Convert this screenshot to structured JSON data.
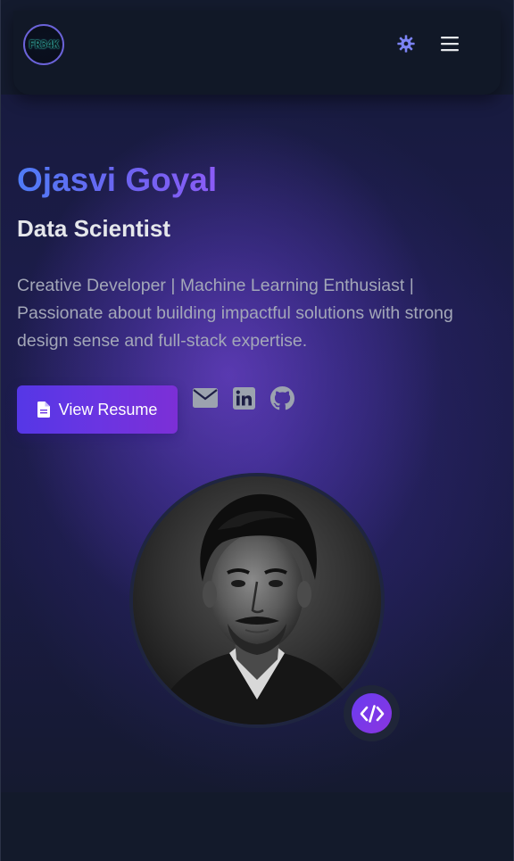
{
  "header": {
    "logo_text": "FR34K",
    "theme_icon": "gear-icon",
    "menu_icon": "hamburger-menu-icon"
  },
  "hero": {
    "name": "Ojasvi Goyal",
    "role": "Data Scientist",
    "bio": "Creative Developer | Machine Learning Enthusiast | Passionate about building impactful solutions with strong design sense and full-stack expertise.",
    "resume_button": "View Resume",
    "resume_icon": "file-icon",
    "social": [
      {
        "icon": "envelope-icon"
      },
      {
        "icon": "linkedin-icon"
      },
      {
        "icon": "github-icon"
      }
    ],
    "badge_icon": "code-icon"
  },
  "colors": {
    "accent": "#5b3ee6",
    "name_gradient_start": "#4f7cf7",
    "name_gradient_end": "#8b5cf6",
    "background": "#131a2b"
  }
}
